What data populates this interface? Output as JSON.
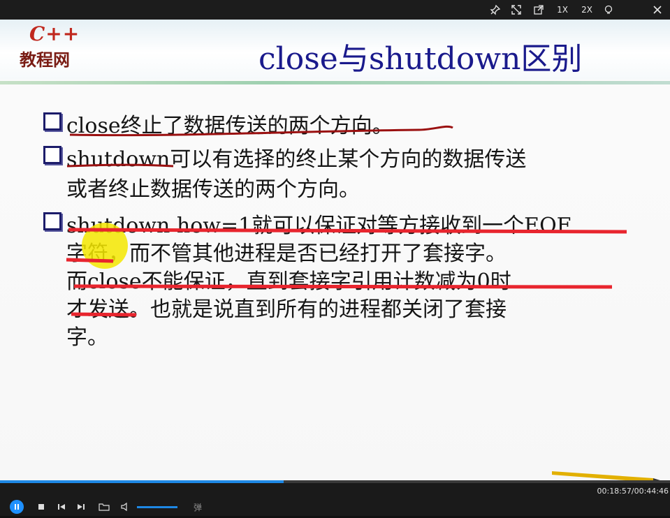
{
  "player": {
    "toolbar": {
      "pin_icon": "pin-icon",
      "fullscreen_icon": "expand-icon",
      "popout_icon": "popout-icon",
      "speed_1x": "1X",
      "speed_2x": "2X",
      "light_icon": "bulb-icon",
      "close_icon": "close-icon"
    },
    "time_display": "00:18:57/00:44:46",
    "progress_fraction": 0.4235,
    "volume_fraction": 1.0,
    "danmu_label": "弹"
  },
  "slide": {
    "logo_top": "C++",
    "logo_bottom": "教程网",
    "title": "close与shutdown区别",
    "bullets": [
      {
        "lines": [
          "close终止了数据传送的两个方向。"
        ]
      },
      {
        "lines": [
          "shutdown可以有选择的终止某个方向的数据传送",
          "或者终止数据传送的两个方向。"
        ]
      },
      {
        "lines": [
          "shutdown how=1就可以保证对等方接收到一个EOF",
          "字符，而不管其他进程是否已经打开了套接字。",
          "而close不能保证，直到套接字引用计数减为0时",
          "才发送。也就是说直到所有的进程都关闭了套接",
          "字。"
        ]
      }
    ]
  },
  "colors": {
    "title": "#1a1a8c",
    "annotation_red": "#e8252e",
    "annotation_dark_red": "#9a1010",
    "highlighter": "#f5e800",
    "progress": "#1e88e5"
  }
}
